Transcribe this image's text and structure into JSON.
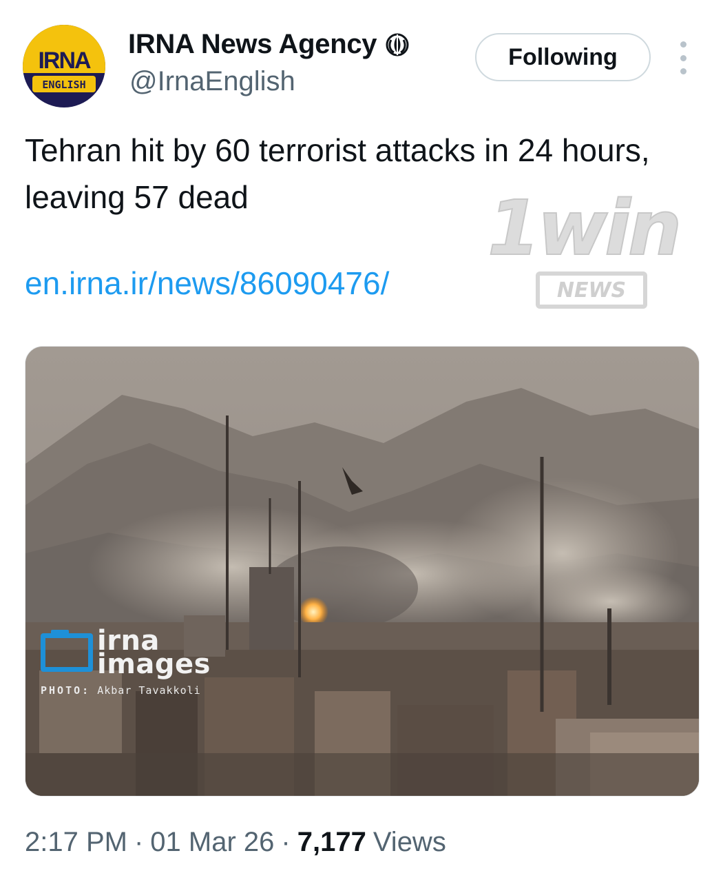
{
  "account": {
    "display_name": "IRNA News Agency",
    "handle": "@IrnaEnglish",
    "avatar_logo_text": "IRNA",
    "avatar_sub_text": "ENGLISH",
    "emblem_icon": "iran-emblem-icon",
    "colors": {
      "avatar_top": "#f4c20d",
      "avatar_bottom": "#1d1b54",
      "avatar_logo": "#1d1b54"
    }
  },
  "actions": {
    "follow_label": "Following",
    "more_icon": "more-vertical-icon"
  },
  "tweet": {
    "text": "Tehran hit by 60 terrorist attacks in 24 hours, leaving 57 dead",
    "link": "en.irna.ir/news/86090476/",
    "link_color": "#1d9bf0"
  },
  "watermark": {
    "brand": "1win",
    "sub": "NEWS"
  },
  "media": {
    "overlay_brand_line1": "irna",
    "overlay_brand_line2": "images",
    "credit_label": "PHOTO:",
    "credit_name": "Akbar Tavakkoli",
    "colors": {
      "brand_blue": "#1e90d8"
    }
  },
  "footer": {
    "time": "2:17 PM",
    "date": "01 Mar 26",
    "views_count": "7,177",
    "views_label": "Views"
  }
}
